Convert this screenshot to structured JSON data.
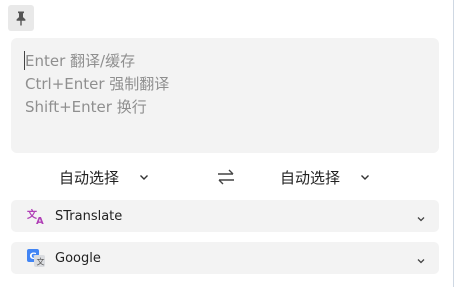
{
  "pin": {
    "icon": "pin-icon"
  },
  "input": {
    "placeholder": "Enter 翻译/缓存\nCtrl+Enter 强制翻译\nShift+Enter 换行",
    "value": ""
  },
  "languages": {
    "source": "自动选择",
    "target": "自动选择",
    "swap_icon": "swap-icon"
  },
  "services": [
    {
      "name": "STranslate",
      "icon": "translate-icon",
      "icon_color": "#b03fb6"
    },
    {
      "name": "Google",
      "icon": "google-translate-icon",
      "icon_color": "#4285f4"
    }
  ]
}
